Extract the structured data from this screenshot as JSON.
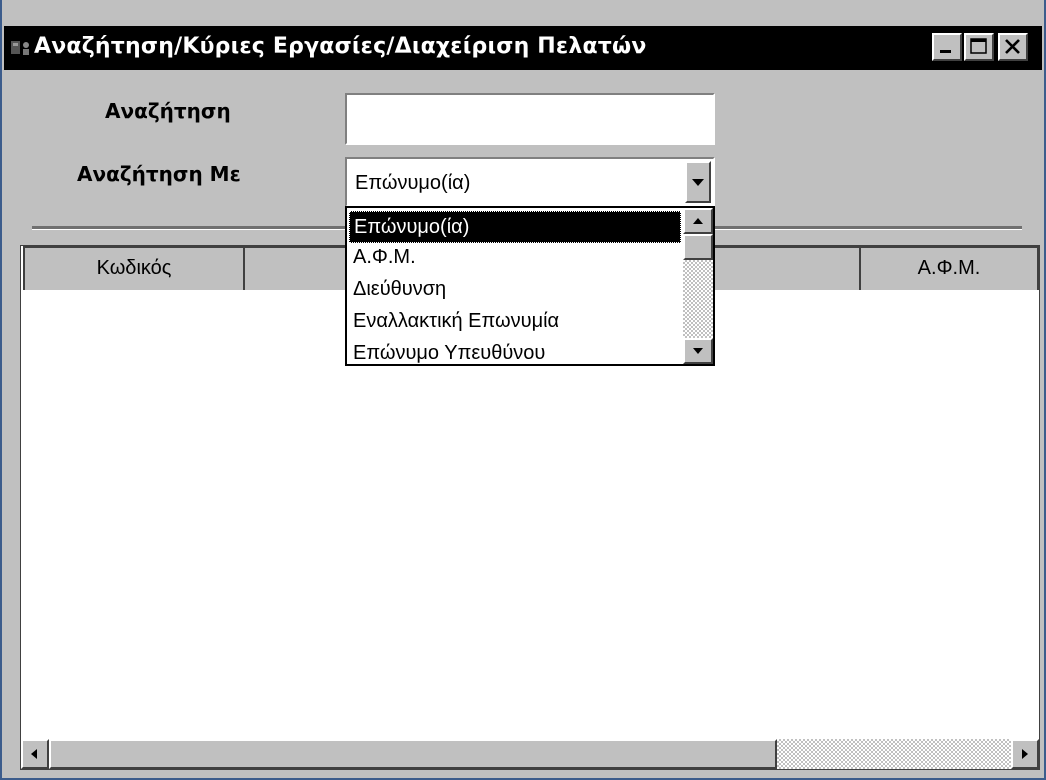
{
  "window": {
    "title": "Αναζήτηση/Κύριες Εργασίες/Διαχείριση Πελατών",
    "controls": [
      "minimize",
      "maximize",
      "close"
    ]
  },
  "search": {
    "label": "Αναζήτηση",
    "value": ""
  },
  "search_by": {
    "label": "Αναζήτηση Με",
    "selected": "Επώνυμο(ία)",
    "options": [
      "Επώνυμο(ία)",
      "Α.Φ.Μ.",
      "Διεύθυνση",
      "Εναλλακτική Επωνυμία",
      "Επώνυμο Υπευθύνου"
    ]
  },
  "grid": {
    "columns": [
      "Κωδικός",
      "",
      "Α.Φ.Μ."
    ],
    "rows": []
  },
  "colors": {
    "titlebar": "#000000",
    "window_bg": "#c0c0c0",
    "selection": "#000000"
  }
}
